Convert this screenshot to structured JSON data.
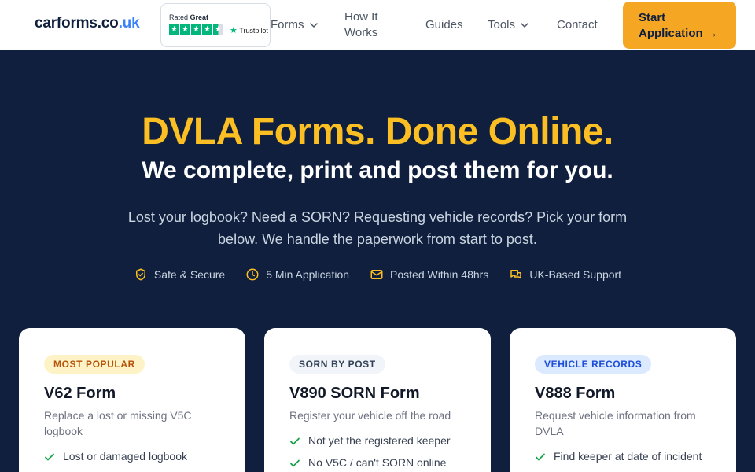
{
  "header": {
    "logo_main": "carforms.co",
    "logo_accent": ".uk",
    "trustpilot": {
      "rated": "Rated",
      "rating_word": "Great",
      "brand": "Trustpilot"
    },
    "nav": {
      "forms": "Forms",
      "how_it_works": "How It Works",
      "guides": "Guides",
      "tools": "Tools",
      "contact": "Contact"
    },
    "cta": "Start Application →"
  },
  "hero": {
    "title": "DVLA Forms. Done Online.",
    "subtitle": "We complete, print and post them for you.",
    "description": "Lost your logbook? Need a SORN? Requesting vehicle records? Pick your form below. We handle the paperwork from start to post.",
    "badges": [
      {
        "icon": "shield-check-icon",
        "label": "Safe & Secure"
      },
      {
        "icon": "clock-icon",
        "label": "5 Min Application"
      },
      {
        "icon": "mail-icon",
        "label": "Posted Within 48hrs"
      },
      {
        "icon": "chat-icon",
        "label": "UK-Based Support"
      }
    ]
  },
  "cards": [
    {
      "tag": "MOST POPULAR",
      "title": "V62 Form",
      "description": "Replace a lost or missing V5C logbook",
      "features": [
        "Lost or damaged logbook"
      ]
    },
    {
      "tag": "SORN BY POST",
      "title": "V890 SORN Form",
      "description": "Register your vehicle off the road",
      "features": [
        "Not yet the registered keeper",
        "No V5C / can't SORN online"
      ]
    },
    {
      "tag": "VEHICLE RECORDS",
      "title": "V888 Form",
      "description": "Request vehicle information from DVLA",
      "features": [
        "Find keeper at date of incident"
      ]
    }
  ],
  "colors": {
    "hero_bg": "#0f1f3d",
    "accent_yellow": "#fbbf24",
    "cta_orange": "#f5a623",
    "check_green": "#16a34a",
    "trustpilot_green": "#00b67a"
  }
}
